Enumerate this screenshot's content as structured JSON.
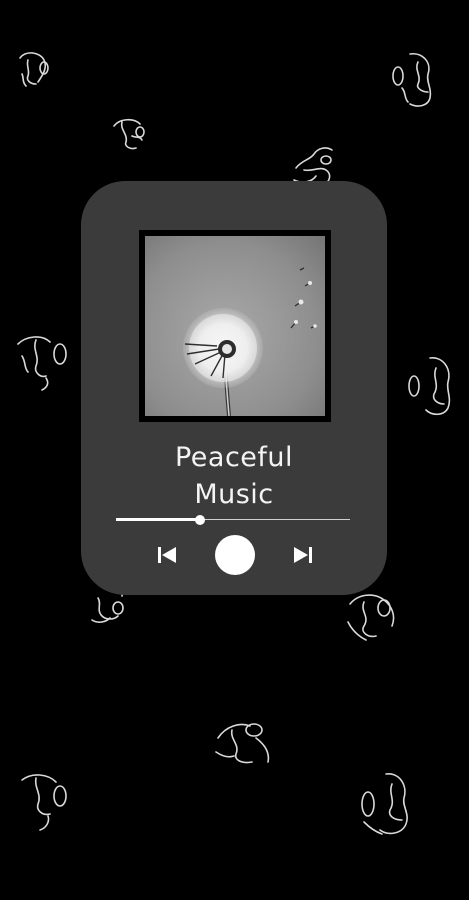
{
  "player": {
    "title": "Peaceful Music",
    "progress_fraction": 0.36,
    "controls": {
      "previous_icon": "skip-previous-icon",
      "play_icon": "play-circle-icon",
      "next_icon": "skip-next-icon"
    },
    "album_art": "dandelion-photo"
  },
  "theme": {
    "background": "#000000",
    "card": "#3b3b3b",
    "foreground": "#ffffff"
  },
  "decorations": {
    "doodle_icon": "line-art-face-icon"
  }
}
